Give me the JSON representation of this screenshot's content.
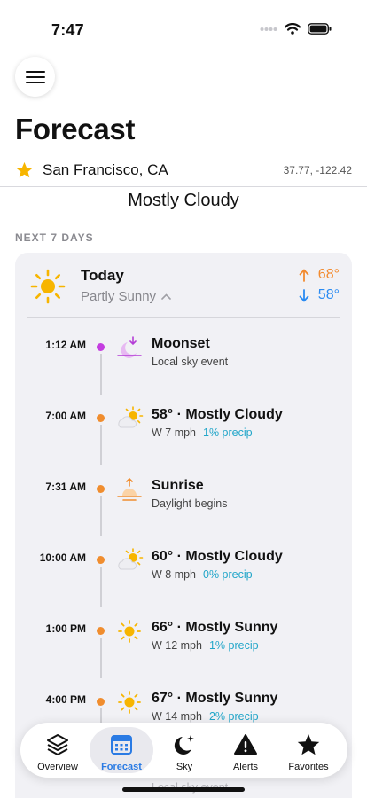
{
  "status": {
    "time": "7:47"
  },
  "header": {
    "menu_icon": "hamburger-icon",
    "title": "Forecast",
    "location": "San Francisco, CA",
    "location_icon": "star-icon",
    "coords": "37.77, -122.42"
  },
  "current": {
    "condition": "Mostly Cloudy"
  },
  "week": {
    "section_label": "NEXT 7 DAYS",
    "today": {
      "label": "Today",
      "condition": "Partly Sunny",
      "high": "68°",
      "low": "58°"
    },
    "events": [
      {
        "time": "1:12 AM",
        "title": "Moonset",
        "sub": "Local sky event",
        "precip": "",
        "icon": "moonset-icon",
        "dot_color": "#c43de0"
      },
      {
        "time": "7:00 AM",
        "title": "58° · Mostly Cloudy",
        "sub": "W 7 mph",
        "precip": "1% precip",
        "icon": "partly-cloudy-icon",
        "dot_color": "#f08d2e"
      },
      {
        "time": "7:31 AM",
        "title": "Sunrise",
        "sub": "Daylight begins",
        "precip": "",
        "icon": "sunrise-icon",
        "dot_color": "#f08d2e"
      },
      {
        "time": "10:00 AM",
        "title": "60° · Mostly Cloudy",
        "sub": "W 8 mph",
        "precip": "0% precip",
        "icon": "partly-cloudy-icon",
        "dot_color": "#f08d2e"
      },
      {
        "time": "1:00 PM",
        "title": "66° · Mostly Sunny",
        "sub": "W 12 mph",
        "precip": "1% precip",
        "icon": "sun-icon",
        "dot_color": "#f08d2e"
      },
      {
        "time": "4:00 PM",
        "title": "67° · Mostly Sunny",
        "sub": "W 14 mph",
        "precip": "2% precip",
        "icon": "sun-icon",
        "dot_color": "#f08d2e"
      }
    ],
    "peek_text": "Local sky event"
  },
  "tabs": [
    {
      "label": "Overview",
      "icon": "layers-icon",
      "active": false
    },
    {
      "label": "Forecast",
      "icon": "calendar-icon",
      "active": true
    },
    {
      "label": "Sky",
      "icon": "moon-stars-icon",
      "active": false
    },
    {
      "label": "Alerts",
      "icon": "warning-icon",
      "active": false
    },
    {
      "label": "Favorites",
      "icon": "star-icon",
      "active": false
    }
  ],
  "colors": {
    "accent_blue": "#2a7be4",
    "high_orange": "#f28b30",
    "low_blue": "#2a8bf2",
    "precip_teal": "#22a6c9",
    "sun_yellow": "#f7b500"
  }
}
